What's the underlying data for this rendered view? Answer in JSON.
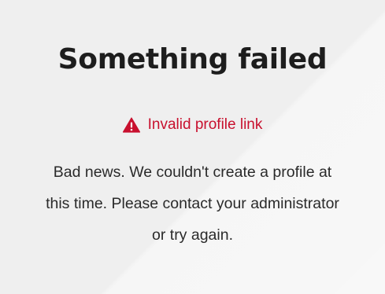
{
  "error_page": {
    "title": "Something failed",
    "alert": {
      "icon": "warning-triangle-icon",
      "text": "Invalid profile link",
      "color": "#c8102e"
    },
    "message_lines": [
      "Bad news. We couldn't create a profile at",
      "this time. Please contact your administrator",
      "or try again."
    ]
  },
  "colors": {
    "background": "#efefef",
    "title": "#1d1d1d",
    "text": "#2a2a2a",
    "error": "#c8102e"
  }
}
